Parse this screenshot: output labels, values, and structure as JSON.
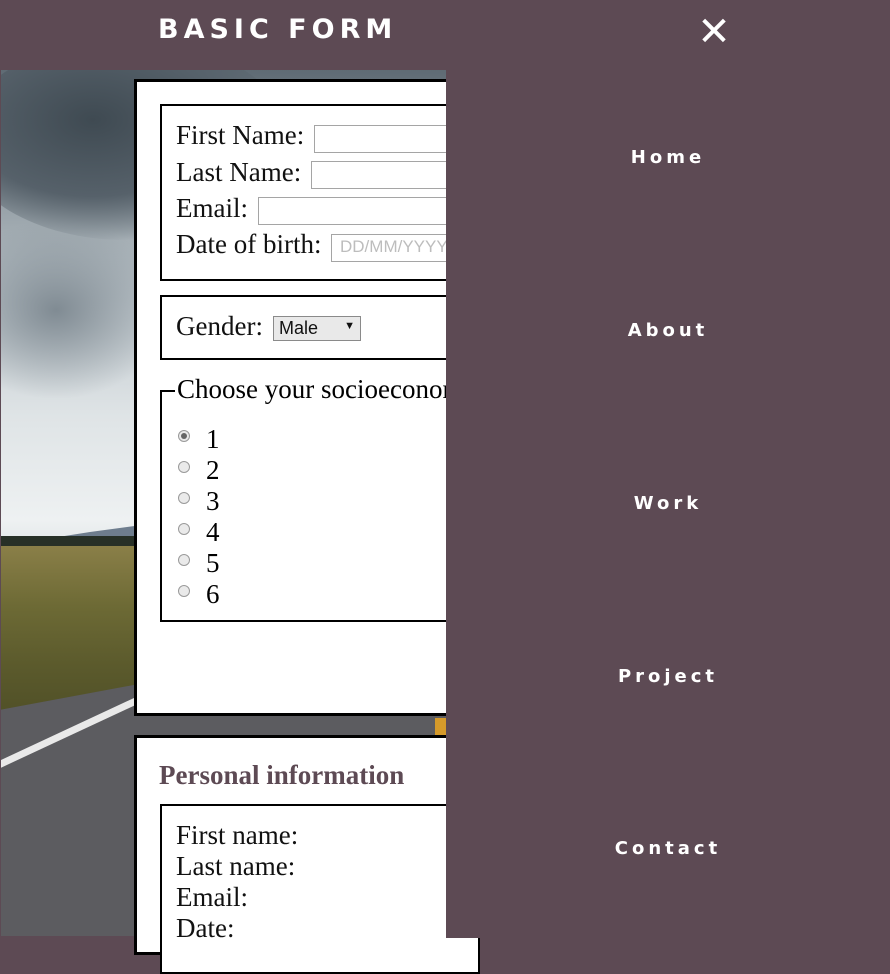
{
  "header": {
    "brand": "BASIC FORM",
    "close_glyph": "✕"
  },
  "form": {
    "first_name_label": "First Name:",
    "last_name_label": "Last Name:",
    "email_label": "Email:",
    "dob_label": "Date of birth:",
    "dob_placeholder": "DD/MM/YYYY",
    "gender_label": "Gender:",
    "gender_selected": "Male",
    "socio_legend": "Choose your socioeconomic",
    "socio_options": [
      "1",
      "2",
      "3",
      "4",
      "5",
      "6"
    ],
    "socio_selected": "1"
  },
  "personal": {
    "title": "Personal information",
    "first_name_label": "First name:",
    "last_name_label": "Last name:",
    "email_label": "Email:",
    "date_label": "Date:"
  },
  "nav": {
    "items": [
      {
        "label": "Home"
      },
      {
        "label": "About"
      },
      {
        "label": "Work"
      },
      {
        "label": "Project"
      },
      {
        "label": "Contact"
      }
    ]
  },
  "colors": {
    "theme": "#5d4a54",
    "accent_text": "#5d4a54"
  },
  "icons": {
    "close": "close-icon",
    "dropdown": "chevron-down-icon"
  }
}
